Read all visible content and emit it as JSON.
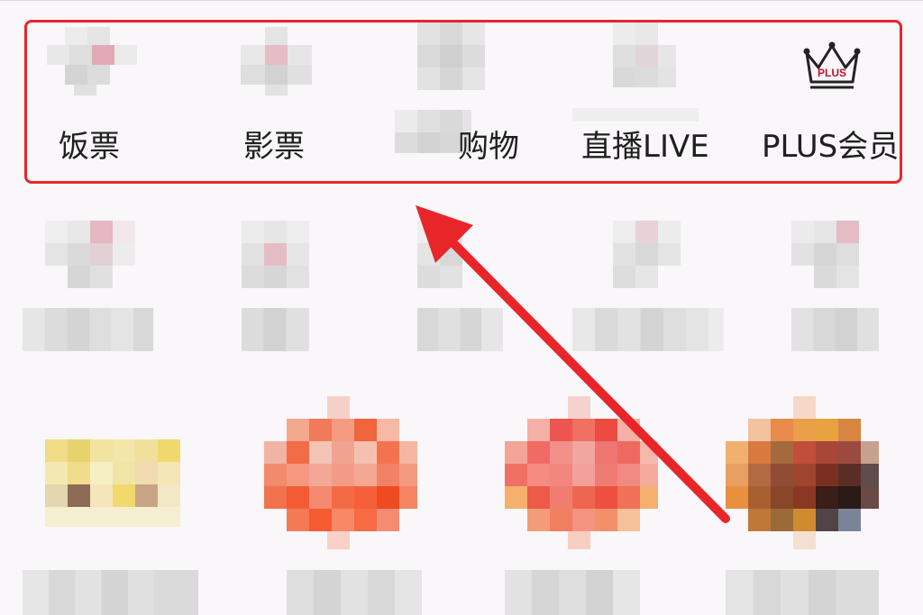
{
  "top_row": {
    "items": [
      {
        "label": "饭票",
        "icon": "meal-ticket-icon"
      },
      {
        "label": "影票",
        "icon": "movie-ticket-icon"
      },
      {
        "label": "购物",
        "icon": "shopping-icon"
      },
      {
        "label": "直播LIVE",
        "icon": "live-stream-icon"
      },
      {
        "label": "PLUS会员",
        "icon": "plus-crown-icon",
        "badge_text": "PLUS"
      }
    ]
  },
  "colors": {
    "highlight": "#e8262a",
    "arrow": "#e8262a",
    "crown": "#c8102e"
  }
}
